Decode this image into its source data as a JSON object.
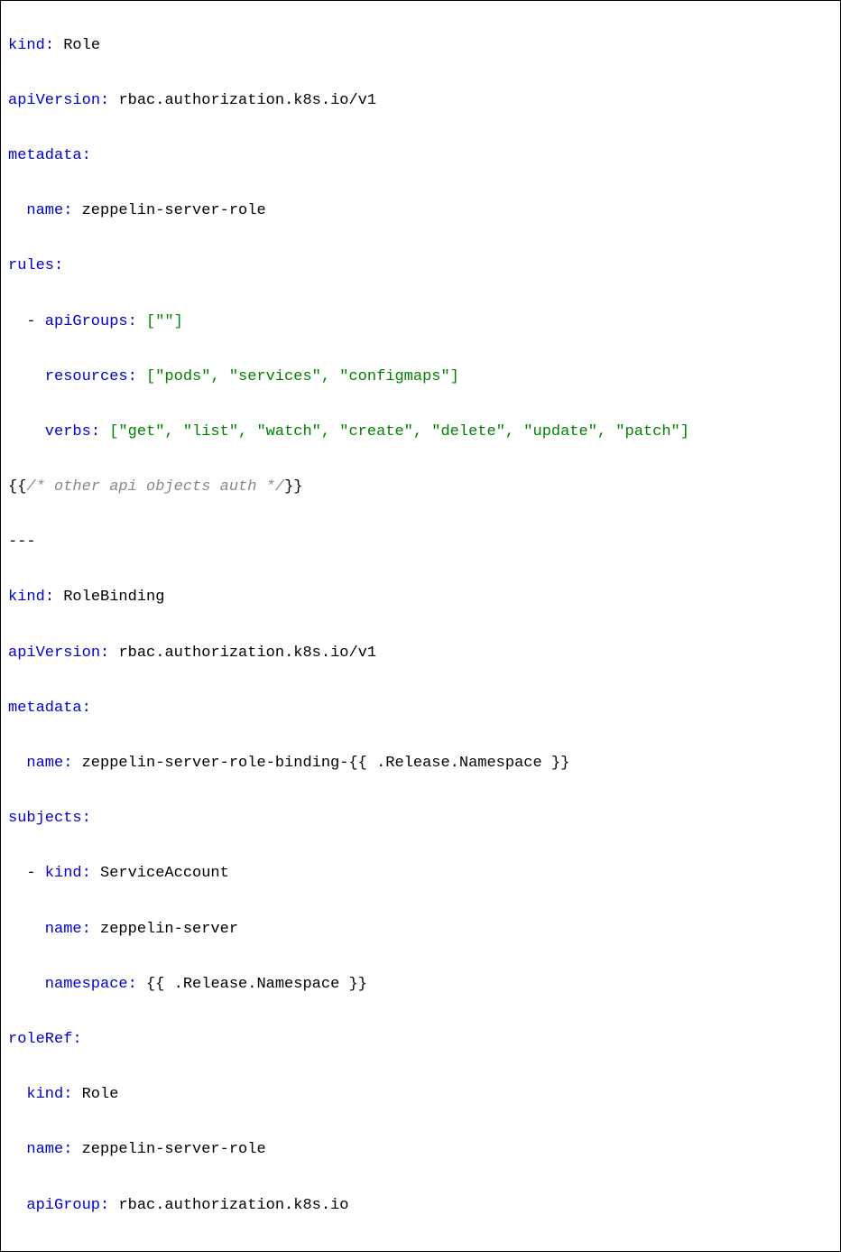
{
  "role": {
    "kind_key": "kind",
    "kind_value": "Role",
    "apiVersion_key": "apiVersion",
    "apiVersion_value": "rbac.authorization.k8s.io/v1",
    "metadata_key": "metadata",
    "name_key": "name",
    "name_value": "zeppelin-server-role",
    "rules_key": "rules",
    "apiGroups_key": "apiGroups",
    "apiGroups_value": "[\"\"]",
    "resources_key": "resources",
    "resources_value": "[\"pods\", \"services\", \"configmaps\"]",
    "verbs_key": "verbs",
    "verbs_value": "[\"get\", \"list\", \"watch\", \"create\", \"delete\", \"update\", \"patch\"]",
    "comment_open": "{{",
    "comment_text": "/* other api objects auth */",
    "comment_close": "}}"
  },
  "separator": "---",
  "rolebinding": {
    "kind_key": "kind",
    "kind_value": "RoleBinding",
    "apiVersion_key": "apiVersion",
    "apiVersion_value": "rbac.authorization.k8s.io/v1",
    "metadata_key": "metadata",
    "name_key": "name",
    "name_value": "zeppelin-server-role-binding-{{ .Release.Namespace }}",
    "subjects_key": "subjects",
    "subject_kind_key": "kind",
    "subject_kind_value": "ServiceAccount",
    "subject_name_key": "name",
    "subject_name_value": "zeppelin-server",
    "subject_namespace_key": "namespace",
    "subject_namespace_value": "{{ .Release.Namespace }}",
    "roleRef_key": "roleRef",
    "roleRef_kind_key": "kind",
    "roleRef_kind_value": "Role",
    "roleRef_name_key": "name",
    "roleRef_name_value": "zeppelin-server-role",
    "roleRef_apiGroup_key": "apiGroup",
    "roleRef_apiGroup_value": "rbac.authorization.k8s.io"
  }
}
